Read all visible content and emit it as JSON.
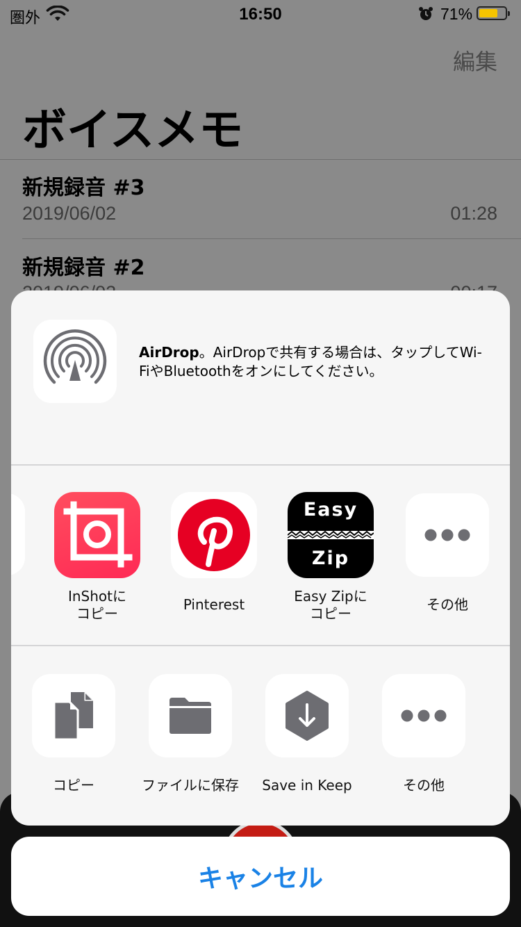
{
  "status_bar": {
    "carrier": "圏外",
    "time": "16:50",
    "battery_percent": "71%",
    "battery_level": 0.71,
    "icons": [
      "wifi-icon",
      "alarm-icon",
      "battery-icon"
    ]
  },
  "header": {
    "edit_label": "編集",
    "title": "ボイスメモ"
  },
  "recordings": [
    {
      "title": "新規録音 #3",
      "date": "2019/06/02",
      "duration": "01:28"
    },
    {
      "title": "新規録音 #2",
      "date": "2019/06/02",
      "duration": "00:17"
    }
  ],
  "share_sheet": {
    "airdrop": {
      "icon": "airdrop-icon",
      "title": "AirDrop",
      "message": "。AirDropで共有する場合は、タップしてWi-FiやBluetoothをオンにしてください。"
    },
    "apps": [
      {
        "label": "InShotに\nコピー",
        "icon": "inshot-icon",
        "color": "#ff3d57"
      },
      {
        "label": "Pinterest",
        "icon": "pinterest-icon",
        "color": "#e60023"
      },
      {
        "label": "Easy Zipに\nコピー",
        "icon": "easy-zip-icon",
        "color": "#000000",
        "text_top": "Easy",
        "text_bottom": "Zip"
      },
      {
        "label": "その他",
        "icon": "more-icon"
      }
    ],
    "actions": [
      {
        "label": "コピー",
        "icon": "copy-icon"
      },
      {
        "label": "ファイルに保存",
        "icon": "folder-icon"
      },
      {
        "label": "Save in Keep",
        "icon": "keep-icon"
      },
      {
        "label": "その他",
        "icon": "more-icon"
      }
    ],
    "cancel_label": "キャンセル"
  },
  "colors": {
    "accent": "#1a82e6",
    "record": "#c41c14",
    "battery": "#f5c400",
    "icon_gray": "#6d6d72"
  }
}
